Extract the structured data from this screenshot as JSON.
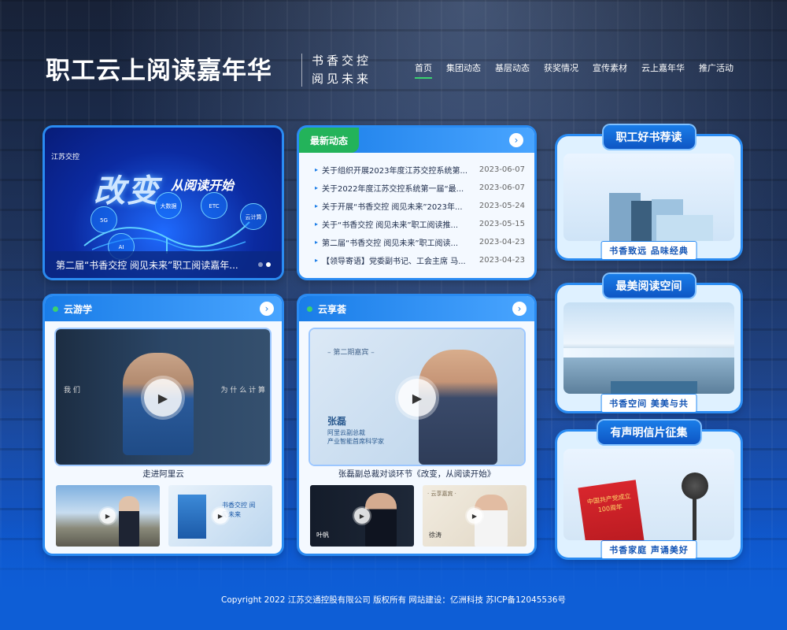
{
  "header": {
    "logo": "职工云上阅读嘉年华",
    "slogan_line1": "书香交控",
    "slogan_line2": "阅见未来",
    "nav": [
      "首页",
      "集团动态",
      "基层动态",
      "获奖情况",
      "宣传素材",
      "云上嘉年华",
      "推广活动"
    ],
    "active_nav": "首页"
  },
  "banner": {
    "brand": "江苏交控",
    "headline": "改变",
    "sub": "从阅读开始",
    "nodes": [
      "5G",
      "AI",
      "ETC",
      "大数据",
      "云计算"
    ],
    "caption": "第二届“书香交控 阅见未来”职工阅读嘉年..."
  },
  "news": {
    "tab": "最新动态",
    "more": "›",
    "items": [
      {
        "title": "关于组织开展2023年度江苏交控系统第...",
        "date": "2023-06-07"
      },
      {
        "title": "关于2022年度江苏交控系统第一届“最...",
        "date": "2023-06-07"
      },
      {
        "title": "关于开展“书香交控 阅见未来”2023年...",
        "date": "2023-05-24"
      },
      {
        "title": "关于“书香交控 阅见未来”职工阅读推...",
        "date": "2023-05-15"
      },
      {
        "title": "第二届“书香交控 阅见未来”职工阅读...",
        "date": "2023-04-23"
      },
      {
        "title": "【领导寄语】党委副书记、工会主席 马...",
        "date": "2023-04-23"
      }
    ]
  },
  "cloud_study": {
    "title": "云游学",
    "more": "›",
    "main_caption": "走进阿里云",
    "overlay_left": "我 们",
    "overlay_right": "为 什 么 计 算",
    "thumb2_text": "书香交控 阅见未来"
  },
  "cloud_share": {
    "title": "云享荟",
    "more": "›",
    "episode": "– 第二期嘉宾 –",
    "guest_name": "张磊",
    "guest_title1": "阿里云副总裁",
    "guest_title2": "产业智能首席科学家",
    "main_caption": "张磊副总裁对谈环节《改变，从阅读开始》",
    "thumb1_name": "叶帆",
    "thumb2_name": "徐涛",
    "thumb2_label": "· 云享嘉宾 ·"
  },
  "side": [
    {
      "title": "职工好书荐读",
      "tag": "书香致远 品味经典"
    },
    {
      "title": "最美阅读空间",
      "tag": "书香空间 美美与共"
    },
    {
      "title": "有声明信片征集",
      "tag": "书香家庭 声诵美好",
      "img_text": "中国共产党成立100周年"
    }
  ],
  "footer": "Copyright 2022 江苏交通控股有限公司 版权所有 网站建设：亿洲科技 苏ICP备12045536号"
}
